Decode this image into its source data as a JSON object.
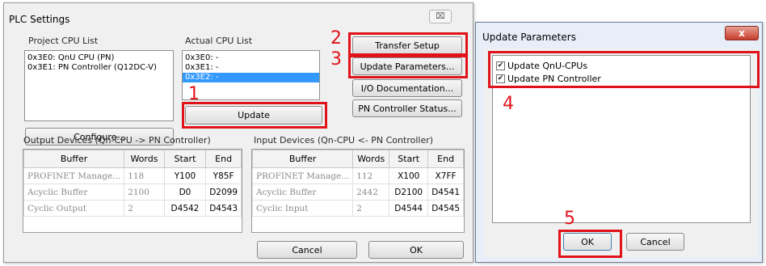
{
  "plc": {
    "title": "PLC Settings",
    "close_glyph": "⌧",
    "project_cpu_list": {
      "label": "Project CPU List",
      "items": [
        "0x3E0: QnU CPU (PN)",
        "0x3E1: PN Controller (Q12DC-V)"
      ]
    },
    "actual_cpu_list": {
      "label": "Actual CPU List",
      "items": [
        "0x3E0: -",
        "0x3E1: -",
        "0x3E2: -"
      ],
      "selected_index": 2
    },
    "buttons": {
      "configure": "Configure...",
      "update": "Update",
      "transfer_setup": "Transfer Setup",
      "update_parameters": "Update Parameters...",
      "io_documentation": "I/O Documentation...",
      "pn_controller_status": "PN Controller Status...",
      "cancel": "Cancel",
      "ok": "OK"
    },
    "output_devices": {
      "label": "Output Devices (Qn-CPU -> PN Controller)",
      "columns": [
        "Buffer",
        "Words",
        "Start",
        "End"
      ],
      "rows": [
        [
          "PROFINET Manage...",
          "118",
          "Y100",
          "Y85F"
        ],
        [
          "Acyclic Buffer",
          "2100",
          "D0",
          "D2099"
        ],
        [
          "Cyclic Output",
          "2",
          "D4542",
          "D4543"
        ]
      ]
    },
    "input_devices": {
      "label": "Input Devices (Qn-CPU <- PN Controller)",
      "columns": [
        "Buffer",
        "Words",
        "Start",
        "End"
      ],
      "rows": [
        [
          "PROFINET Manage...",
          "112",
          "X100",
          "X7FF"
        ],
        [
          "Acyclic Buffer",
          "2442",
          "D2100",
          "D4541"
        ],
        [
          "Cyclic Input",
          "2",
          "D4544",
          "D4545"
        ]
      ]
    }
  },
  "update_params": {
    "title": "Update Parameters",
    "close_glyph": "x",
    "checkboxes": [
      {
        "label": "Update QnU-CPUs",
        "checked": true
      },
      {
        "label": "Update PN Controller",
        "checked": true
      }
    ],
    "check_glyph": "✔",
    "buttons": {
      "ok": "OK",
      "cancel": "Cancel"
    }
  },
  "annotations": {
    "n1": "1",
    "n2": "2",
    "n3": "3",
    "n4": "4",
    "n5": "5",
    "color": "#e0131b"
  }
}
